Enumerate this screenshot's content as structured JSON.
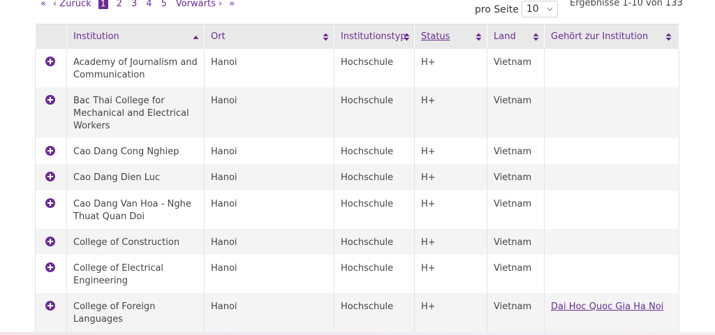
{
  "pager": {
    "first": "«",
    "prev": "‹ Zurück",
    "pages": [
      "1",
      "2",
      "3",
      "4",
      "5"
    ],
    "current_page": "1",
    "next": "Vorwärts ›",
    "last": "»"
  },
  "per_page": {
    "label": "pro Seite",
    "value": "10"
  },
  "results_text": "Ergebnisse 1-10 von 133",
  "columns": {
    "institution": "Institution",
    "ort": "Ort",
    "typ": "Institutionstyp",
    "status": "Status",
    "land": "Land",
    "gehoert": "Gehört zur Institution"
  },
  "rows": [
    {
      "institution": "Academy of Journalism and Communication",
      "ort": "Hanoi",
      "typ": "Hochschule",
      "status": "H+",
      "land": "Vietnam",
      "gehoert": ""
    },
    {
      "institution": "Bac Thai College for Mechanical and Electrical Workers",
      "ort": "Hanoi",
      "typ": "Hochschule",
      "status": "H+",
      "land": "Vietnam",
      "gehoert": ""
    },
    {
      "institution": "Cao Dang Cong Nghiep",
      "ort": "Hanoi",
      "typ": "Hochschule",
      "status": "H+",
      "land": "Vietnam",
      "gehoert": ""
    },
    {
      "institution": "Cao Dang Dien Luc",
      "ort": "Hanoi",
      "typ": "Hochschule",
      "status": "H+",
      "land": "Vietnam",
      "gehoert": ""
    },
    {
      "institution": "Cao Dang Van Hoa - Nghe Thuat Quan Doi",
      "ort": "Hanoi",
      "typ": "Hochschule",
      "status": "H+",
      "land": "Vietnam",
      "gehoert": ""
    },
    {
      "institution": "College of Construction",
      "ort": "Hanoi",
      "typ": "Hochschule",
      "status": "H+",
      "land": "Vietnam",
      "gehoert": ""
    },
    {
      "institution": "College of Electrical Engineering",
      "ort": "Hanoi",
      "typ": "Hochschule",
      "status": "H+",
      "land": "Vietnam",
      "gehoert": ""
    },
    {
      "institution": "College of Foreign Languages",
      "ort": "Hanoi",
      "typ": "Hochschule",
      "status": "H+",
      "land": "Vietnam",
      "gehoert": "Dai Hoc Quoc Gia Ha Noi"
    }
  ],
  "colors": {
    "accent": "#6b2c91",
    "header_bg": "#e9e9e9",
    "row_alt": "#f4f4f4"
  },
  "icons": {
    "expand": "plus-circle-icon",
    "sort_both": "sort-icon",
    "sort_asc": "sort-asc-icon"
  }
}
